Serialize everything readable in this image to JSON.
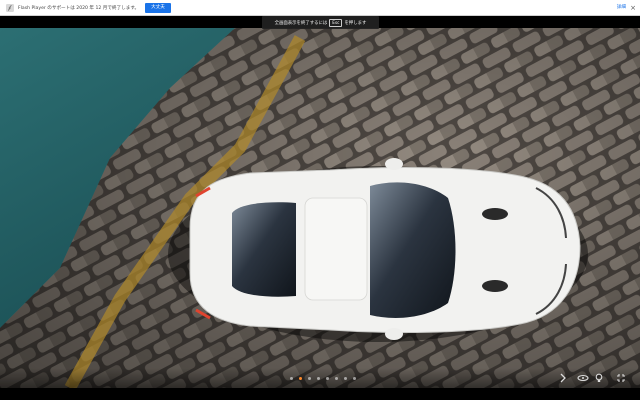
{
  "flash_bar": {
    "message": "Flash Player のサポートは 2020 年 12 月で終了します。",
    "button_label": "大丈夫",
    "more_label": "詳細",
    "close_glyph": "×"
  },
  "fullscreen_toast": {
    "prefix": "全画面表示を終了するには",
    "key": "Esc",
    "suffix": "を押します"
  },
  "viewer": {
    "image_description_icon": "car-top-view",
    "pagination": {
      "count": 8,
      "active_index": 1
    }
  },
  "controls": {
    "icons": [
      "arrow-icon",
      "rotate-360-icon",
      "lightbulb-icon",
      "fullscreen-exit-icon"
    ]
  },
  "colors": {
    "accent": "#1a73e8",
    "active_dot": "#ff8a2a",
    "car_body": "#f2f2f0"
  }
}
